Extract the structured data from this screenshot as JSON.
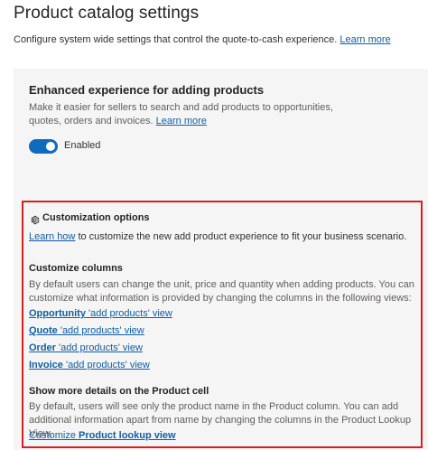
{
  "header": {
    "title": "Product catalog settings",
    "description": "Configure system wide settings that control the quote-to-cash experience.",
    "learn_more": "Learn more"
  },
  "enhanced": {
    "title": "Enhanced experience for adding products",
    "description": "Make it easier for sellers to search and add products to opportunities, quotes, orders and invoices.",
    "learn_more": "Learn more",
    "toggle_label": "Enabled",
    "toggle_on": true
  },
  "customization": {
    "title": "Customization options",
    "icon": "gear-icon",
    "learn_how": "Learn how",
    "learn_how_suffix": "to customize the new add product experience to fit your business scenario.",
    "columns": {
      "title": "Customize columns",
      "description": "By default users can change the unit, price and quantity when adding products. You can customize what information is provided by changing the columns in the following views:",
      "links": [
        {
          "bold": "Opportunity",
          "rest": " 'add products' view"
        },
        {
          "bold": "Quote",
          "rest": " 'add products' view"
        },
        {
          "bold": "Order",
          "rest": " 'add products' view"
        },
        {
          "bold": "Invoice",
          "rest": " 'add products' view"
        }
      ]
    },
    "details": {
      "title": "Show more details on the Product cell",
      "description": "By default, users will see only the product name in the Product column. You can add additional information apart from name by changing the columns in the Product Lookup View.",
      "link_prefix": "Customize ",
      "link_bold": "Product lookup view"
    }
  },
  "colors": {
    "accent": "#0f6cbd",
    "highlight_border": "#d6201f",
    "link": "#115ea3"
  }
}
